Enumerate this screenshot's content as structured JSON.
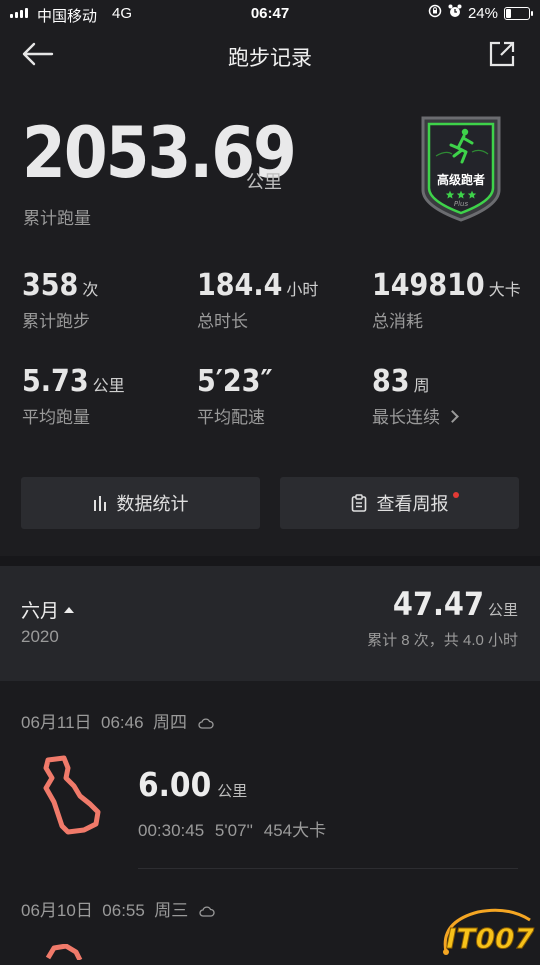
{
  "status_bar": {
    "carrier": "中国移动",
    "network": "4G",
    "time": "06:47",
    "battery": "24%",
    "battery_level": 0.24
  },
  "header": {
    "title": "跑步记录",
    "back_icon": "arrow-left-icon",
    "share_icon": "share-icon"
  },
  "summary": {
    "total_distance": "2053.69",
    "total_unit": "公里",
    "total_label": "累计跑量",
    "badge_text": "高级跑者",
    "badge_stars": 3,
    "badge_brand": "Plus",
    "accent_color": "#3ed24a"
  },
  "stats": [
    {
      "value": "358",
      "unit": "次",
      "label": "累计跑步"
    },
    {
      "value": "184.4",
      "unit": "小时",
      "label": "总时长"
    },
    {
      "value": "149810",
      "unit": "大卡",
      "label": "总消耗"
    },
    {
      "value": "5.73",
      "unit": "公里",
      "label": "平均跑量"
    },
    {
      "value": "5′23″",
      "unit": "",
      "label": "平均配速"
    },
    {
      "value": "83",
      "unit": "周",
      "label": "最长连续"
    }
  ],
  "buttons": {
    "stats": "数据统计",
    "weekly": "查看周报"
  },
  "month": {
    "name": "六月",
    "year": "2020",
    "distance": "47.47",
    "unit": "公里",
    "summary": "累计 8 次，共 4.0 小时"
  },
  "runs": [
    {
      "date": "06月11日",
      "time": "06:46",
      "weekday": "周四",
      "weather_icon": "cloud-icon",
      "distance": "6.00",
      "unit": "公里",
      "duration": "00:30:45",
      "pace": "5'07''",
      "calories": "454大卡"
    },
    {
      "date": "06月10日",
      "time": "06:55",
      "weekday": "周三",
      "weather_icon": "cloud-icon"
    }
  ],
  "watermark": "IT007",
  "route_color": "#f07a6a"
}
